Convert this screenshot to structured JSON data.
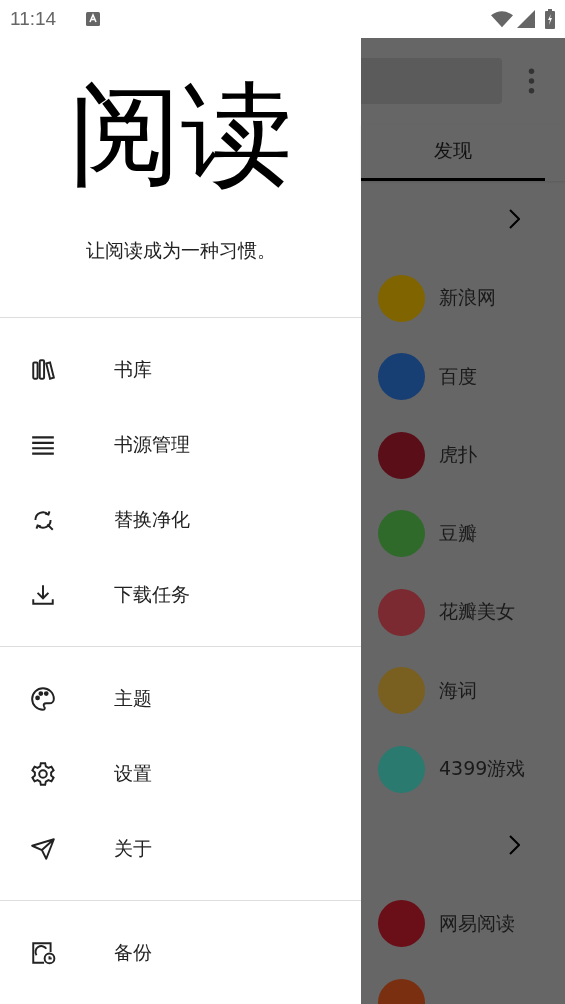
{
  "status_bar": {
    "time": "11:14"
  },
  "drawer": {
    "title": "阅读",
    "slogan": "让阅读成为一种习惯。",
    "sections": [
      [
        {
          "label": "书库"
        },
        {
          "label": "书源管理"
        },
        {
          "label": "替换净化"
        },
        {
          "label": "下载任务"
        }
      ],
      [
        {
          "label": "主题"
        },
        {
          "label": "设置"
        },
        {
          "label": "关于"
        }
      ],
      [
        {
          "label": "备份"
        }
      ]
    ]
  },
  "background": {
    "tabs": [
      {
        "label": "发现",
        "selected": true
      }
    ],
    "entries": [
      {
        "kind": "chevron"
      },
      {
        "kind": "site",
        "label": "新浪网",
        "color": "#806400"
      },
      {
        "kind": "site",
        "label": "百度",
        "color": "#173f74"
      },
      {
        "kind": "site",
        "label": "虎扑",
        "color": "#5a0e17"
      },
      {
        "kind": "site",
        "label": "豆瓣",
        "color": "#2f6a2b"
      },
      {
        "kind": "site",
        "label": "花瓣美女",
        "color": "#7a2a30"
      },
      {
        "kind": "site",
        "label": "海词",
        "color": "#7a6020"
      },
      {
        "kind": "site",
        "label": "4399游戏",
        "color": "#2a7a70"
      },
      {
        "kind": "chevron"
      },
      {
        "kind": "site",
        "label": "网易阅读",
        "color": "#6a0e18"
      },
      {
        "kind": "site",
        "color": "#7a3010"
      }
    ]
  }
}
